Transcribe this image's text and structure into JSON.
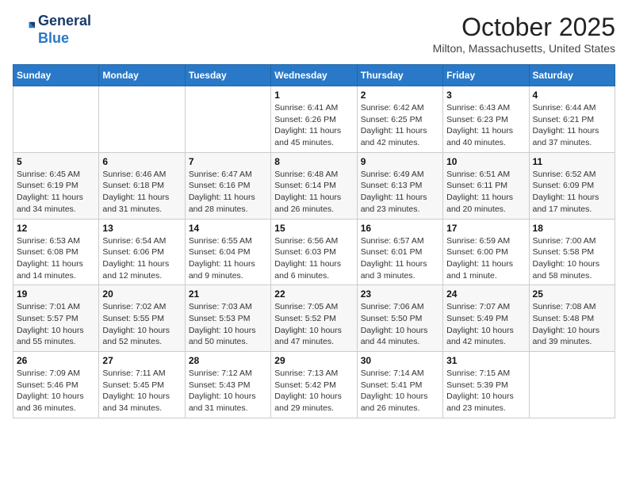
{
  "logo": {
    "line1": "General",
    "line2": "Blue"
  },
  "title": "October 2025",
  "location": "Milton, Massachusetts, United States",
  "days_of_week": [
    "Sunday",
    "Monday",
    "Tuesday",
    "Wednesday",
    "Thursday",
    "Friday",
    "Saturday"
  ],
  "weeks": [
    [
      {
        "day": "",
        "info": ""
      },
      {
        "day": "",
        "info": ""
      },
      {
        "day": "",
        "info": ""
      },
      {
        "day": "1",
        "info": "Sunrise: 6:41 AM\nSunset: 6:26 PM\nDaylight: 11 hours and 45 minutes."
      },
      {
        "day": "2",
        "info": "Sunrise: 6:42 AM\nSunset: 6:25 PM\nDaylight: 11 hours and 42 minutes."
      },
      {
        "day": "3",
        "info": "Sunrise: 6:43 AM\nSunset: 6:23 PM\nDaylight: 11 hours and 40 minutes."
      },
      {
        "day": "4",
        "info": "Sunrise: 6:44 AM\nSunset: 6:21 PM\nDaylight: 11 hours and 37 minutes."
      }
    ],
    [
      {
        "day": "5",
        "info": "Sunrise: 6:45 AM\nSunset: 6:19 PM\nDaylight: 11 hours and 34 minutes."
      },
      {
        "day": "6",
        "info": "Sunrise: 6:46 AM\nSunset: 6:18 PM\nDaylight: 11 hours and 31 minutes."
      },
      {
        "day": "7",
        "info": "Sunrise: 6:47 AM\nSunset: 6:16 PM\nDaylight: 11 hours and 28 minutes."
      },
      {
        "day": "8",
        "info": "Sunrise: 6:48 AM\nSunset: 6:14 PM\nDaylight: 11 hours and 26 minutes."
      },
      {
        "day": "9",
        "info": "Sunrise: 6:49 AM\nSunset: 6:13 PM\nDaylight: 11 hours and 23 minutes."
      },
      {
        "day": "10",
        "info": "Sunrise: 6:51 AM\nSunset: 6:11 PM\nDaylight: 11 hours and 20 minutes."
      },
      {
        "day": "11",
        "info": "Sunrise: 6:52 AM\nSunset: 6:09 PM\nDaylight: 11 hours and 17 minutes."
      }
    ],
    [
      {
        "day": "12",
        "info": "Sunrise: 6:53 AM\nSunset: 6:08 PM\nDaylight: 11 hours and 14 minutes."
      },
      {
        "day": "13",
        "info": "Sunrise: 6:54 AM\nSunset: 6:06 PM\nDaylight: 11 hours and 12 minutes."
      },
      {
        "day": "14",
        "info": "Sunrise: 6:55 AM\nSunset: 6:04 PM\nDaylight: 11 hours and 9 minutes."
      },
      {
        "day": "15",
        "info": "Sunrise: 6:56 AM\nSunset: 6:03 PM\nDaylight: 11 hours and 6 minutes."
      },
      {
        "day": "16",
        "info": "Sunrise: 6:57 AM\nSunset: 6:01 PM\nDaylight: 11 hours and 3 minutes."
      },
      {
        "day": "17",
        "info": "Sunrise: 6:59 AM\nSunset: 6:00 PM\nDaylight: 11 hours and 1 minute."
      },
      {
        "day": "18",
        "info": "Sunrise: 7:00 AM\nSunset: 5:58 PM\nDaylight: 10 hours and 58 minutes."
      }
    ],
    [
      {
        "day": "19",
        "info": "Sunrise: 7:01 AM\nSunset: 5:57 PM\nDaylight: 10 hours and 55 minutes."
      },
      {
        "day": "20",
        "info": "Sunrise: 7:02 AM\nSunset: 5:55 PM\nDaylight: 10 hours and 52 minutes."
      },
      {
        "day": "21",
        "info": "Sunrise: 7:03 AM\nSunset: 5:53 PM\nDaylight: 10 hours and 50 minutes."
      },
      {
        "day": "22",
        "info": "Sunrise: 7:05 AM\nSunset: 5:52 PM\nDaylight: 10 hours and 47 minutes."
      },
      {
        "day": "23",
        "info": "Sunrise: 7:06 AM\nSunset: 5:50 PM\nDaylight: 10 hours and 44 minutes."
      },
      {
        "day": "24",
        "info": "Sunrise: 7:07 AM\nSunset: 5:49 PM\nDaylight: 10 hours and 42 minutes."
      },
      {
        "day": "25",
        "info": "Sunrise: 7:08 AM\nSunset: 5:48 PM\nDaylight: 10 hours and 39 minutes."
      }
    ],
    [
      {
        "day": "26",
        "info": "Sunrise: 7:09 AM\nSunset: 5:46 PM\nDaylight: 10 hours and 36 minutes."
      },
      {
        "day": "27",
        "info": "Sunrise: 7:11 AM\nSunset: 5:45 PM\nDaylight: 10 hours and 34 minutes."
      },
      {
        "day": "28",
        "info": "Sunrise: 7:12 AM\nSunset: 5:43 PM\nDaylight: 10 hours and 31 minutes."
      },
      {
        "day": "29",
        "info": "Sunrise: 7:13 AM\nSunset: 5:42 PM\nDaylight: 10 hours and 29 minutes."
      },
      {
        "day": "30",
        "info": "Sunrise: 7:14 AM\nSunset: 5:41 PM\nDaylight: 10 hours and 26 minutes."
      },
      {
        "day": "31",
        "info": "Sunrise: 7:15 AM\nSunset: 5:39 PM\nDaylight: 10 hours and 23 minutes."
      },
      {
        "day": "",
        "info": ""
      }
    ]
  ]
}
